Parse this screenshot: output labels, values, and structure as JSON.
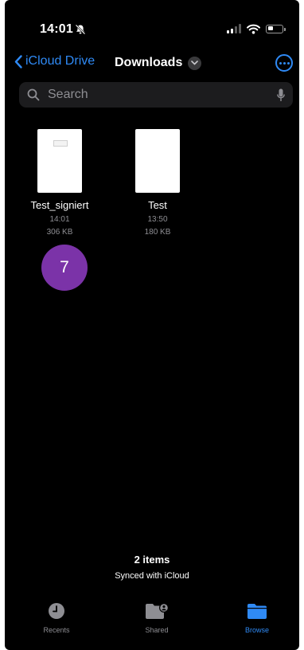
{
  "status": {
    "time": "14:01"
  },
  "nav": {
    "back_label": "iCloud Drive",
    "title": "Downloads"
  },
  "search": {
    "placeholder": "Search"
  },
  "files": [
    {
      "name": "Test_signiert",
      "time": "14:01",
      "size": "306 KB"
    },
    {
      "name": "Test",
      "time": "13:50",
      "size": "180 KB"
    }
  ],
  "badge": {
    "number": "7"
  },
  "footer": {
    "item_count": "2 items",
    "sync_status": "Synced with iCloud"
  },
  "tabs": [
    {
      "label": "Recents",
      "icon": "clock-icon",
      "active": false
    },
    {
      "label": "Shared",
      "icon": "shared-folder-icon",
      "active": false
    },
    {
      "label": "Browse",
      "icon": "folder-icon",
      "active": true
    }
  ],
  "colors": {
    "accent": "#2f8af5",
    "badge": "#7b33a8",
    "background": "#000000",
    "secondary_text": "#8e8e93"
  }
}
